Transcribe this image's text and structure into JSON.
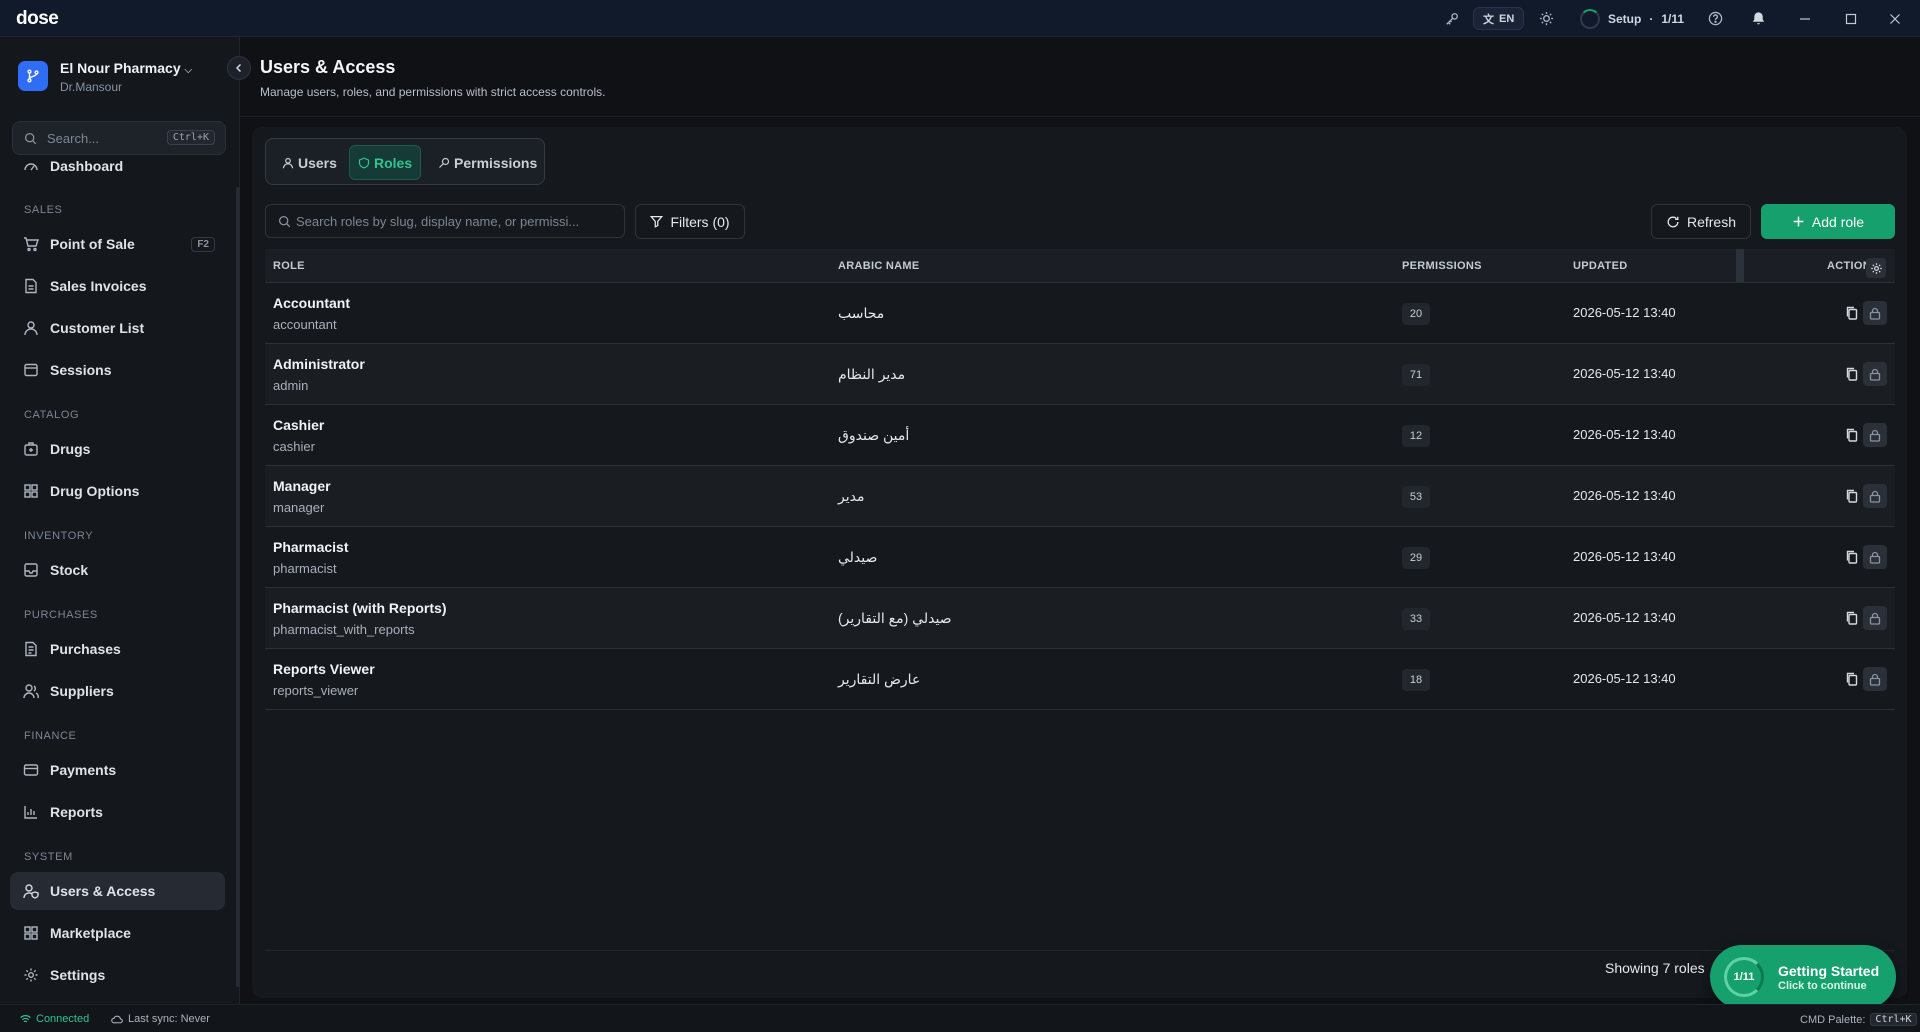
{
  "app": {
    "logo": "dose"
  },
  "titlebar": {
    "lang": "EN",
    "setup_label": "Setup",
    "setup_progress": "1/11"
  },
  "sidebar": {
    "org_name": "El Nour Pharmacy",
    "org_user": "Dr.Mansour",
    "search_placeholder": "Search...",
    "search_shortcut": "Ctrl+K",
    "top_item": "Dashboard",
    "sections": {
      "sales": "SALES",
      "catalog": "CATALOG",
      "inventory": "INVENTORY",
      "purchases": "PURCHASES",
      "finance": "FINANCE",
      "system": "SYSTEM"
    },
    "items": {
      "pos": "Point of Sale",
      "pos_hotkey": "F2",
      "sales_invoices": "Sales Invoices",
      "customer_list": "Customer List",
      "sessions": "Sessions",
      "drugs": "Drugs",
      "drug_options": "Drug Options",
      "stock": "Stock",
      "purchases": "Purchases",
      "suppliers": "Suppliers",
      "payments": "Payments",
      "reports": "Reports",
      "users_access": "Users & Access",
      "marketplace": "Marketplace",
      "settings": "Settings"
    }
  },
  "page": {
    "title": "Users & Access",
    "subtitle": "Manage users, roles, and permissions with strict access controls."
  },
  "tabs": {
    "users": "Users",
    "roles": "Roles",
    "permissions": "Permissions"
  },
  "toolbar": {
    "search_placeholder": "Search roles by slug, display name, or permissi...",
    "filters": "Filters (0)",
    "refresh": "Refresh",
    "add_role": "Add role"
  },
  "table": {
    "headers": {
      "role": "ROLE",
      "arabic": "ARABIC NAME",
      "permissions": "PERMISSIONS",
      "updated": "UPDATED",
      "actions": "ACTIONS"
    },
    "rows": [
      {
        "name": "Accountant",
        "slug": "accountant",
        "arabic": "محاسب",
        "permissions": "20",
        "updated": "2026-05-12 13:40"
      },
      {
        "name": "Administrator",
        "slug": "admin",
        "arabic": "مدير النظام",
        "permissions": "71",
        "updated": "2026-05-12 13:40"
      },
      {
        "name": "Cashier",
        "slug": "cashier",
        "arabic": "أمين صندوق",
        "permissions": "12",
        "updated": "2026-05-12 13:40"
      },
      {
        "name": "Manager",
        "slug": "manager",
        "arabic": "مدير",
        "permissions": "53",
        "updated": "2026-05-12 13:40"
      },
      {
        "name": "Pharmacist",
        "slug": "pharmacist",
        "arabic": "صيدلي",
        "permissions": "29",
        "updated": "2026-05-12 13:40"
      },
      {
        "name": "Pharmacist (with Reports)",
        "slug": "pharmacist_with_reports",
        "arabic": "صيدلي (مع التقارير)",
        "permissions": "33",
        "updated": "2026-05-12 13:40"
      },
      {
        "name": "Reports Viewer",
        "slug": "reports_viewer",
        "arabic": "عارض التقارير",
        "permissions": "18",
        "updated": "2026-05-12 13:40"
      }
    ],
    "footer": "Showing 7 roles"
  },
  "getting_started": {
    "progress": "1/11",
    "title": "Getting Started",
    "subtitle": "Click to continue"
  },
  "statusbar": {
    "connection": "Connected",
    "last_sync": "Last sync: Never",
    "palette_label": "CMD Palette:",
    "palette_key": "Ctrl+K"
  },
  "colors": {
    "accent": "#16a06e",
    "brand_blue": "#2f6df6",
    "background": "#0f1115"
  }
}
